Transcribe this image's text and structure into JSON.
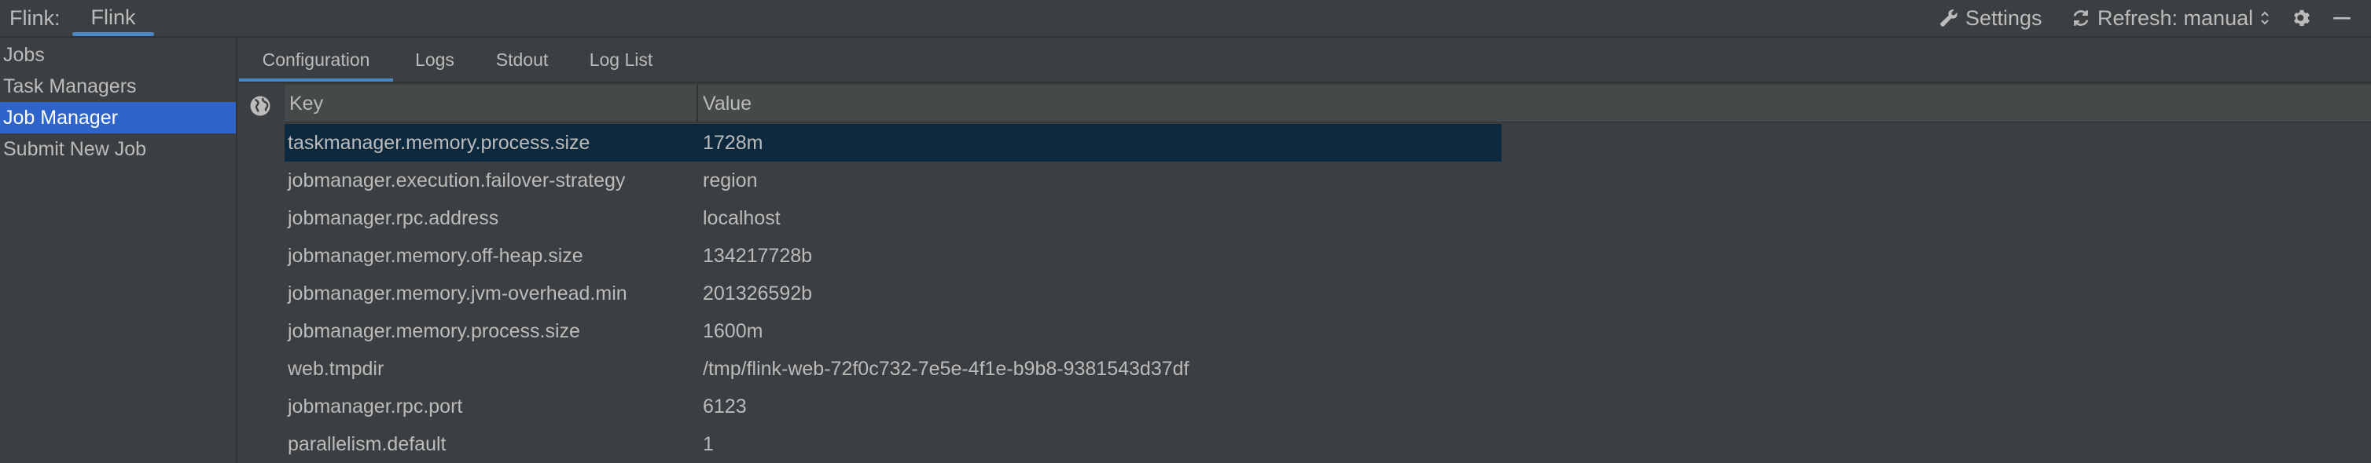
{
  "topbar": {
    "prefix": "Flink:",
    "connection_tab": "Flink",
    "settings_label": "Settings",
    "refresh_label": "Refresh: manual"
  },
  "sidebar": {
    "items": [
      {
        "label": "Jobs"
      },
      {
        "label": "Task Managers"
      },
      {
        "label": "Job Manager"
      },
      {
        "label": "Submit New Job"
      }
    ],
    "selected_index": 2
  },
  "tabs": [
    {
      "label": "Configuration"
    },
    {
      "label": "Logs"
    },
    {
      "label": "Stdout"
    },
    {
      "label": "Log List"
    }
  ],
  "table": {
    "headers": {
      "key": "Key",
      "value": "Value"
    },
    "rows": [
      {
        "key": "taskmanager.memory.process.size",
        "value": "1728m"
      },
      {
        "key": "jobmanager.execution.failover-strategy",
        "value": "region"
      },
      {
        "key": "jobmanager.rpc.address",
        "value": "localhost"
      },
      {
        "key": "jobmanager.memory.off-heap.size",
        "value": "134217728b"
      },
      {
        "key": "jobmanager.memory.jvm-overhead.min",
        "value": "201326592b"
      },
      {
        "key": "jobmanager.memory.process.size",
        "value": "1600m"
      },
      {
        "key": "web.tmpdir",
        "value": "/tmp/flink-web-72f0c732-7e5e-4f1e-b9b8-9381543d37df"
      },
      {
        "key": "jobmanager.rpc.port",
        "value": "6123"
      },
      {
        "key": "parallelism.default",
        "value": "1"
      }
    ]
  },
  "colors": {
    "background": "#3c3f41",
    "accent": "#4a88c7",
    "sidebar_selected": "#2f65ca",
    "row_selected": "#0d293e"
  }
}
